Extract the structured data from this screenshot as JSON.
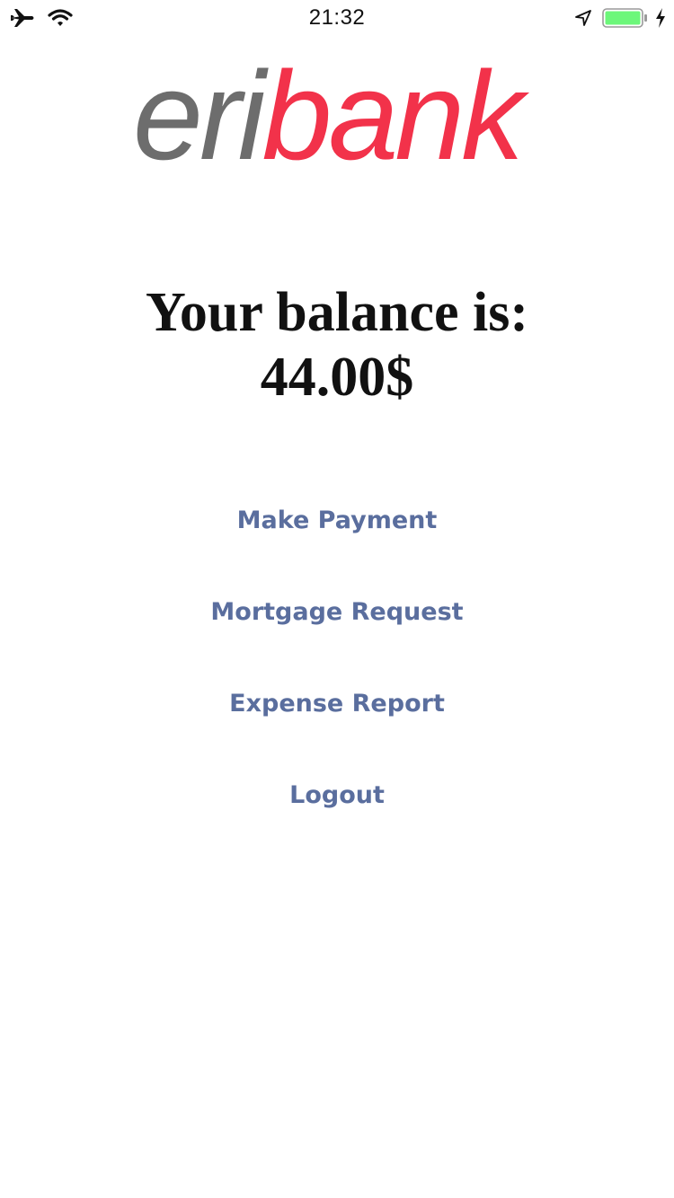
{
  "status_bar": {
    "time": "21:32",
    "icons": [
      "airplane-icon",
      "wifi-icon",
      "location-arrow-icon",
      "battery-icon",
      "charging-bolt-icon"
    ],
    "battery_color": "#6cf77a"
  },
  "logo": {
    "part1": "eri",
    "part2": "bank",
    "color_part1": "#6d6d6d",
    "color_part2": "#f2324a"
  },
  "balance": {
    "label": "Your balance is:",
    "value": "44.00$"
  },
  "menu": {
    "items": [
      {
        "label": "Make Payment"
      },
      {
        "label": "Mortgage Request"
      },
      {
        "label": "Expense Report"
      },
      {
        "label": "Logout"
      }
    ],
    "link_color": "#5a6e9e"
  }
}
